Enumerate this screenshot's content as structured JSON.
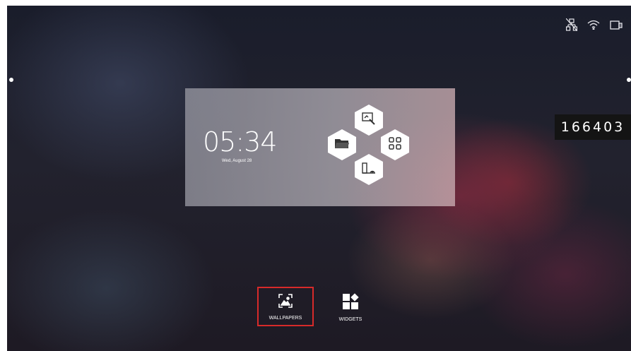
{
  "status_bar": {
    "icons": [
      "ethernet-icon",
      "wifi-icon",
      "screen-mirror-icon"
    ]
  },
  "clock": {
    "time": "05:34",
    "date": "Wed, August 28"
  },
  "quick_apps": [
    "whiteboard-icon",
    "folder-icon",
    "apps-grid-icon",
    "screen-share-icon"
  ],
  "connection_code": "166403",
  "dock": {
    "wallpapers_label": "WALLPAPERS",
    "widgets_label": "WIDGETS"
  },
  "colors": {
    "selection_border": "#d72a2a",
    "badge_bg": "#141414"
  }
}
